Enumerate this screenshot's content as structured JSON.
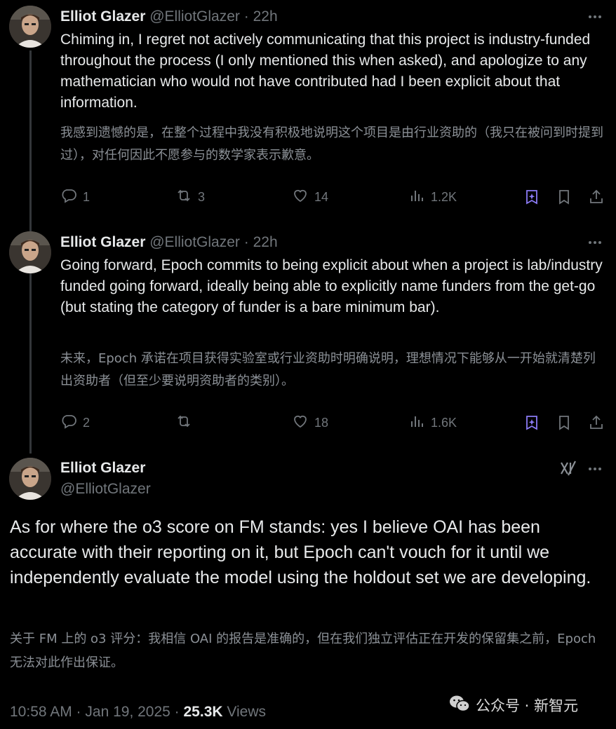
{
  "tweets": [
    {
      "name": "Elliot Glazer",
      "handle": "@ElliotGlazer",
      "time": "22h",
      "text": "Chiming in, I regret not actively communicating that this project is industry-funded throughout the process (I only mentioned this when asked), and apologize to any mathematician who would not have contributed had I been explicit about that information.",
      "translation": "我感到遗憾的是，在整个过程中我没有积极地说明这个项目是由行业资助的（我只在被问到时提到过），对任何因此不愿参与的数学家表示歉意。",
      "replies": "1",
      "reposts": "3",
      "likes": "14",
      "views": "1.2K"
    },
    {
      "name": "Elliot Glazer",
      "handle": "@ElliotGlazer",
      "time": "22h",
      "text": "Going forward, Epoch commits to being explicit about when a project is lab/industry funded going forward, ideally being able to explicitly name funders from the get-go (but stating the category of funder is a bare minimum bar).",
      "translation": "未来，Epoch 承诺在项目获得实验室或行业资助时明确说明，理想情况下能够从一开始就清楚列出资助者（但至少要说明资助者的类别）。",
      "replies": "2",
      "reposts": "",
      "likes": "18",
      "views": "1.6K"
    }
  ],
  "main": {
    "name": "Elliot Glazer",
    "handle": "@ElliotGlazer",
    "text": "As for where the o3 score on FM stands: yes I believe OAI has been accurate with their reporting on it, but Epoch can't vouch for it until we independently evaluate the model using the holdout set we are developing.",
    "translation": "关于 FM 上的 o3 评分：我相信 OAI 的报告是准确的，但在我们独立评估正在开发的保留集之前，Epoch 无法对此作出保证。",
    "timestamp": "10:58 AM · Jan 19, 2025",
    "views_count": "25.3K",
    "views_label": "Views"
  },
  "watermark": "公众号 · 新智元",
  "colors": {
    "background": "#000000",
    "text": "#e7e9ea",
    "muted": "#71767b",
    "grok_accent": "#8b7bf5",
    "thread_line": "#333639"
  },
  "icons": [
    "reply-icon",
    "repost-icon",
    "like-icon",
    "views-icon",
    "grok-icon",
    "bookmark-icon",
    "share-icon",
    "more-icon",
    "grok-logo-icon",
    "wechat-icon"
  ]
}
